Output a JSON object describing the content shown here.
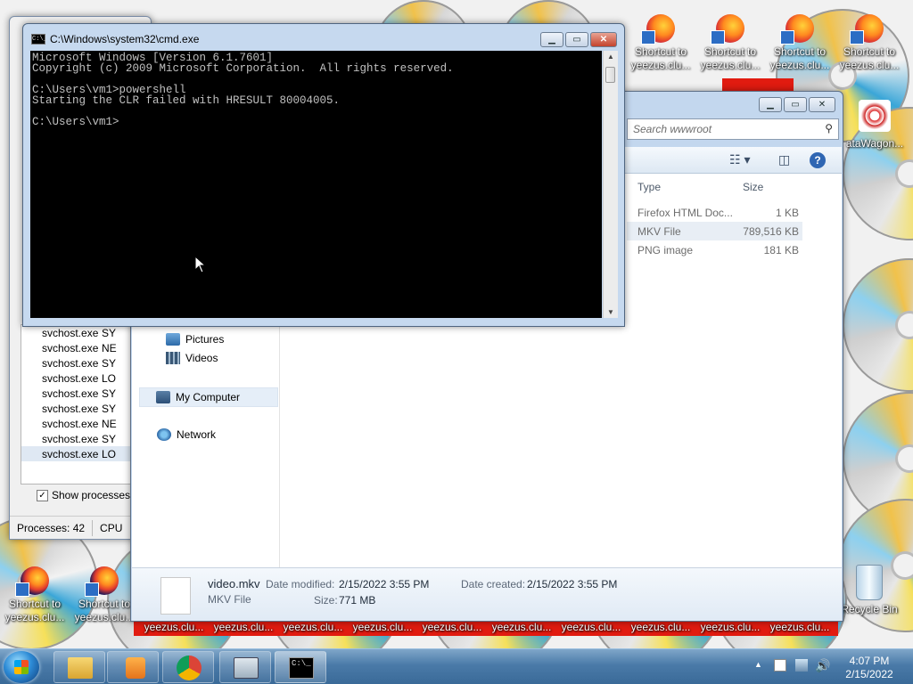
{
  "cmd": {
    "title": "C:\\Windows\\system32\\cmd.exe",
    "lines": [
      "Microsoft Windows [Version 6.1.7601]",
      "Copyright (c) 2009 Microsoft Corporation.  All rights reserved.",
      "",
      "C:\\Users\\vm1>powershell",
      "Starting the CLR failed with HRESULT 80004005.",
      "",
      "C:\\Users\\vm1>"
    ]
  },
  "explorer": {
    "search_placeholder": "Search wwwroot",
    "columns": [
      "Type",
      "Size"
    ],
    "files": [
      {
        "type": "Firefox HTML Doc...",
        "size": "1 KB"
      },
      {
        "type": "MKV File",
        "size": "789,516 KB"
      },
      {
        "type": "PNG image",
        "size": "181 KB"
      }
    ],
    "nav": {
      "pictures": "Pictures",
      "videos": "Videos",
      "my_computer": "My Computer",
      "network": "Network"
    },
    "details": {
      "name": "video.mkv",
      "type": "MKV File",
      "modified_label": "Date modified:",
      "modified_value": "2/15/2022 3:55 PM",
      "created_label": "Date created:",
      "created_value": "2/15/2022 3:55 PM",
      "size_label": "Size:",
      "size_value": "771 MB"
    }
  },
  "taskmgr": {
    "processes": [
      {
        "name": "svchost.exe",
        "user": "SY"
      },
      {
        "name": "svchost.exe",
        "user": "NE"
      },
      {
        "name": "svchost.exe",
        "user": "SY"
      },
      {
        "name": "svchost.exe",
        "user": "LO"
      },
      {
        "name": "svchost.exe",
        "user": "SY"
      },
      {
        "name": "svchost.exe",
        "user": "SY"
      },
      {
        "name": "svchost.exe",
        "user": "NE"
      },
      {
        "name": "svchost.exe",
        "user": "SY"
      },
      {
        "name": "svchost.exe",
        "user": "LO"
      }
    ],
    "show_processes_label": "Show processes fr",
    "processes_count": "Processes: 42",
    "cpu_label": "CPU"
  },
  "desktop": {
    "top_icons": [
      {
        "line1": "Shortcut to",
        "line2": "yeezus.clu..."
      },
      {
        "line1": "Shortcut to",
        "line2": "yeezus.clu..."
      },
      {
        "line1": "Shortcut to",
        "line2": "yeezus.clu..."
      },
      {
        "line1": "Shortcut to",
        "line2": "yeezus.clu..."
      }
    ],
    "datawagon_label": "ataWagon...",
    "bottom_icons": [
      {
        "line1": "Shortcut to",
        "line2": "yeezus.clu..."
      },
      {
        "line1": "Shortcut to",
        "line2": "yeezus.clu..."
      }
    ],
    "bottom_strip_labels": [
      "yeezus.clu...",
      "yeezus.clu...",
      "yeezus.clu...",
      "yeezus.clu...",
      "yeezus.clu...",
      "yeezus.clu...",
      "yeezus.clu...",
      "yeezus.clu...",
      "yeezus.clu...",
      "yeezus.clu..."
    ],
    "recycle_bin": "Recycle Bin"
  },
  "taskbar": {
    "time": "4:07 PM",
    "date": "2/15/2022",
    "buttons": [
      "windows-explorer",
      "media-player",
      "chrome",
      "task-manager",
      "command-prompt"
    ]
  },
  "colors": {
    "console_bg": "#000000",
    "console_fg": "#c0c0c0",
    "taskbar": "#4a7aa8"
  }
}
